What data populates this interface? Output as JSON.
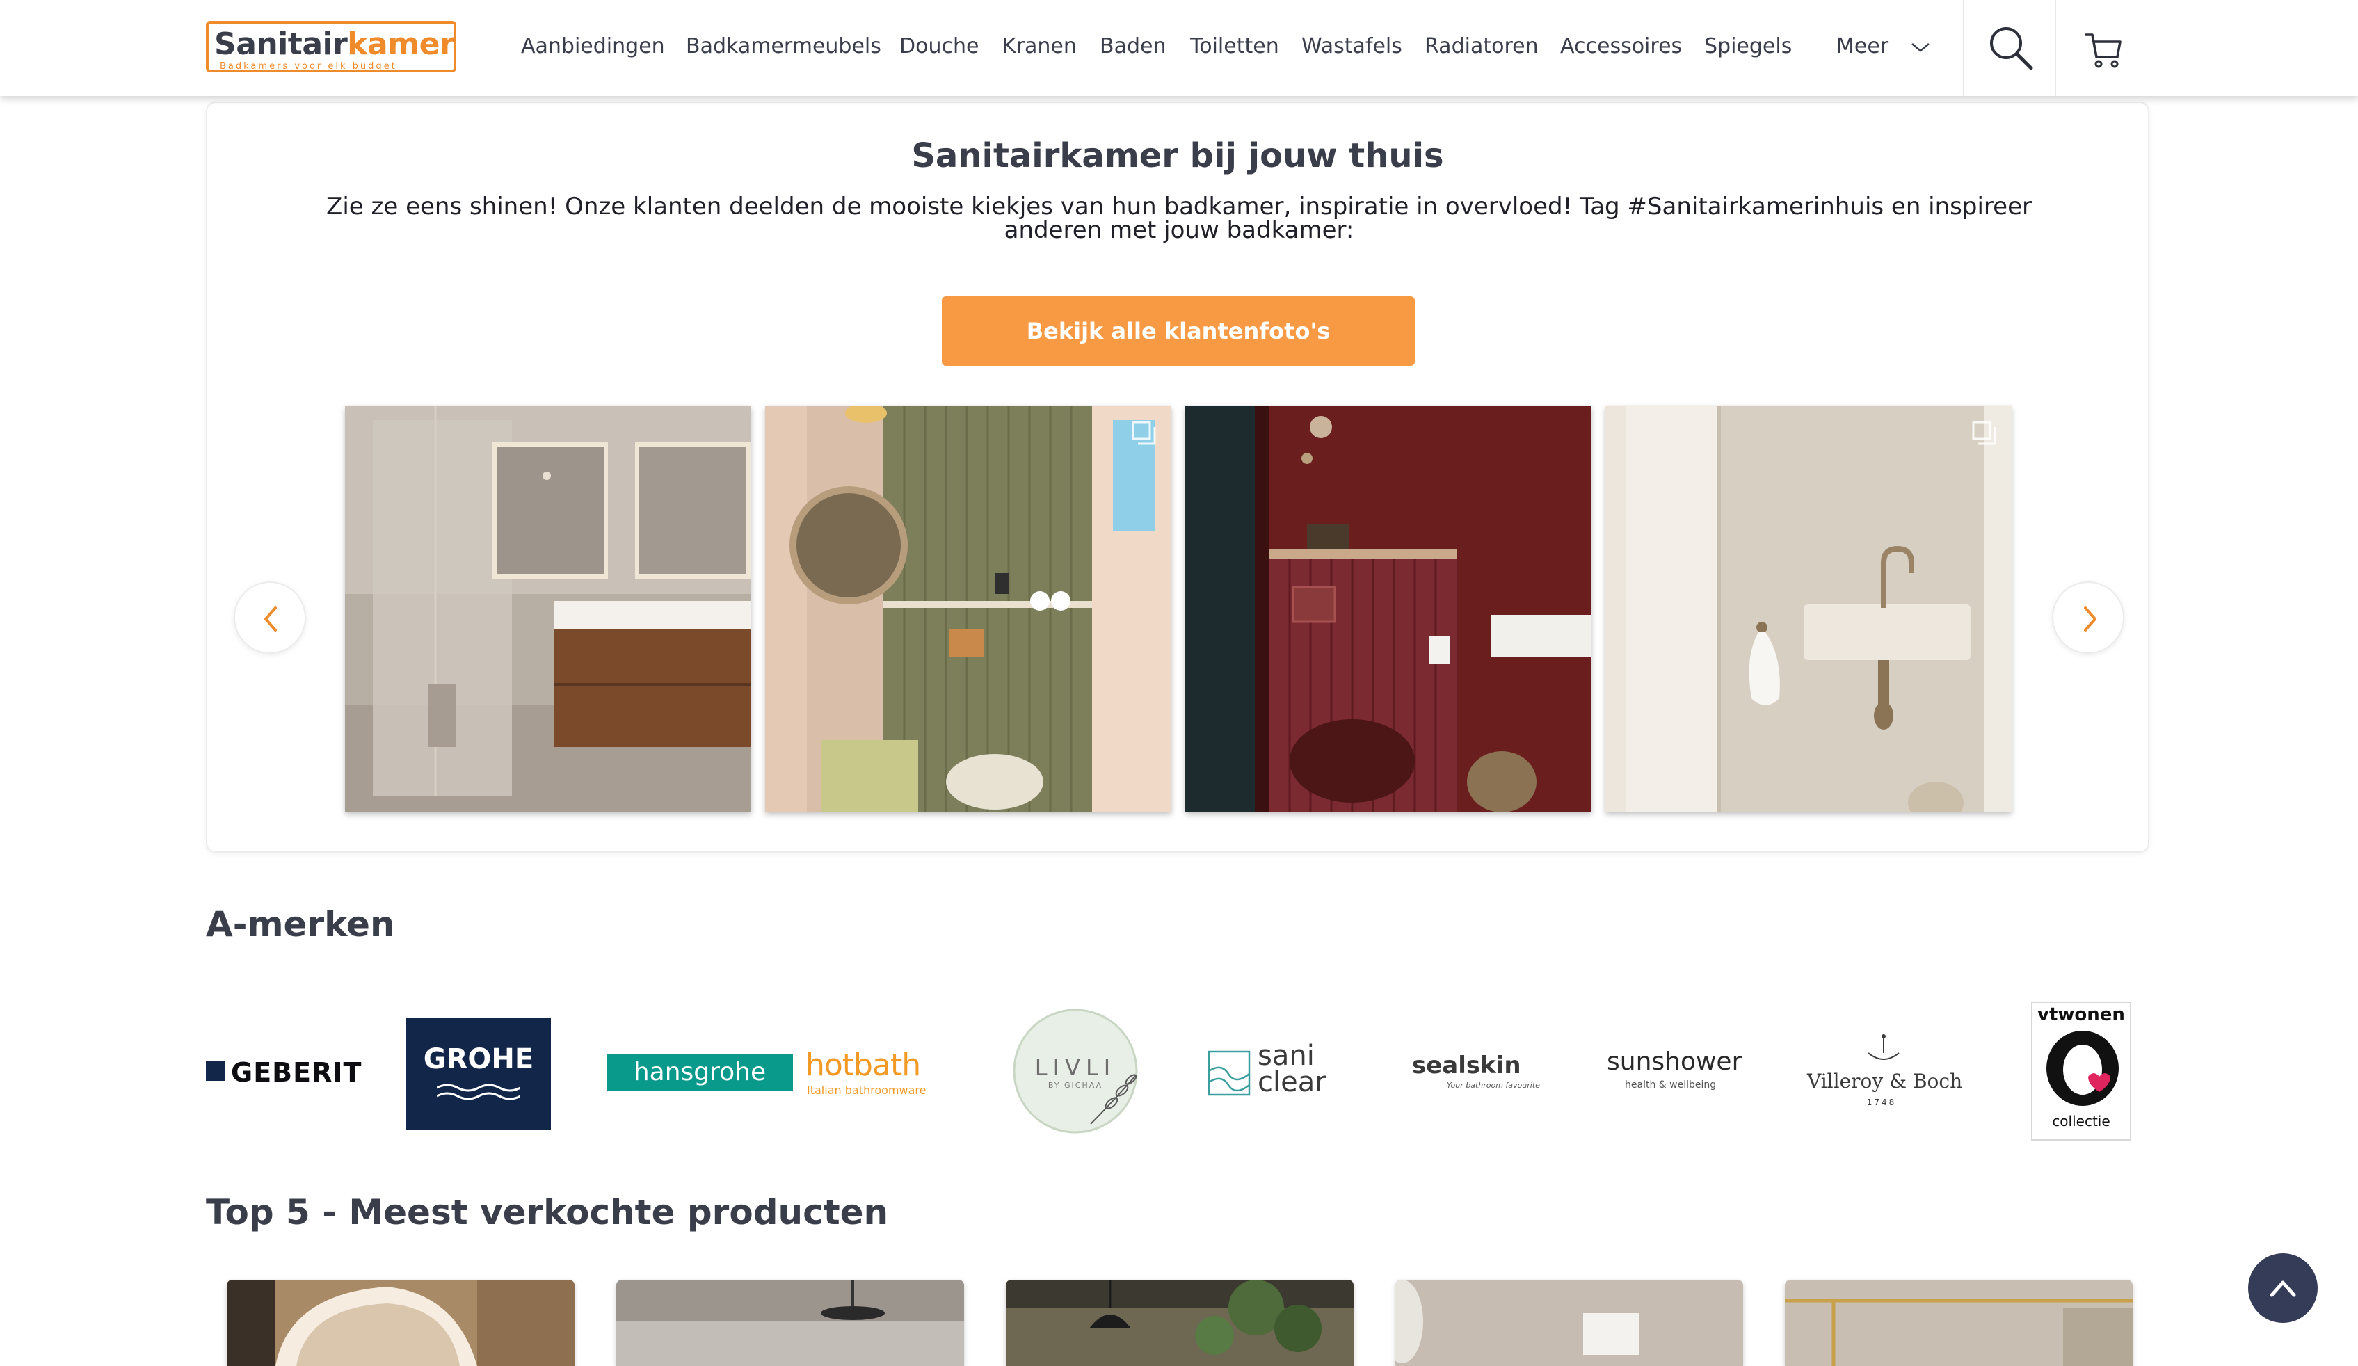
{
  "header": {
    "logo": {
      "main_a": "Sanitair",
      "main_b": "kamer",
      "tagline": "Badkamers voor elk budget"
    },
    "nav": [
      {
        "label": "Aanbiedingen"
      },
      {
        "label": "Badkamermeubels"
      },
      {
        "label": "Douche"
      },
      {
        "label": "Kranen"
      },
      {
        "label": "Baden"
      },
      {
        "label": "Toiletten"
      },
      {
        "label": "Wastafels"
      },
      {
        "label": "Radiatoren"
      },
      {
        "label": "Accessoires"
      },
      {
        "label": "Spiegels"
      }
    ],
    "more_label": "Meer",
    "icons": [
      "chevron-down-icon",
      "search-icon",
      "cart-icon"
    ]
  },
  "customer_photos": {
    "title": "Sanitairkamer bij jouw thuis",
    "description": "Zie ze eens shinen! Onze klanten deelden de mooiste kiekjes van hun badkamer, inspiratie in overvloed! Tag #Sanitairkamerinhuis en inspireer anderen met jouw badkamer:",
    "cta_label": "Bekijk alle klantenfoto's",
    "photos": [
      {
        "subject": "walk-in shower with wooden vanity"
      },
      {
        "subject": "green tiled toilet with round mirror"
      },
      {
        "subject": "burgundy toilet room"
      },
      {
        "subject": "small fountain basin with brass tap"
      }
    ],
    "icons": [
      "chevron-left-icon",
      "chevron-right-icon",
      "gallery-icon"
    ]
  },
  "brands": {
    "title": "A-merken",
    "items": [
      {
        "name": "GEBERIT"
      },
      {
        "name": "GROHE"
      },
      {
        "name": "hansgrohe"
      },
      {
        "name": "hotbath",
        "tagline": "Italian bathroomware"
      },
      {
        "name": "LIVLI",
        "tagline": "BY GICHAA"
      },
      {
        "name": "sani",
        "name2": "clear"
      },
      {
        "name": "sealskin",
        "tagline": "Your bathroom favourite"
      },
      {
        "name": "sunshower",
        "tagline": "health & wellbeing"
      },
      {
        "name": "Villeroy & Boch",
        "tagline": "1748"
      },
      {
        "name": "vtwonen",
        "tagline": "collectie"
      }
    ]
  },
  "products": {
    "title": "Top 5 - Meest verkochte producten"
  },
  "colors": {
    "brand_orange": "#f08b2c",
    "cta_orange": "#f89a44",
    "text_dark": "#3a3d4a",
    "to_top_bg": "#343c58",
    "grohe_bg": "#12264a",
    "hansgrohe_bg": "#0a9a8c",
    "hotbath_orange": "#f29a25"
  }
}
